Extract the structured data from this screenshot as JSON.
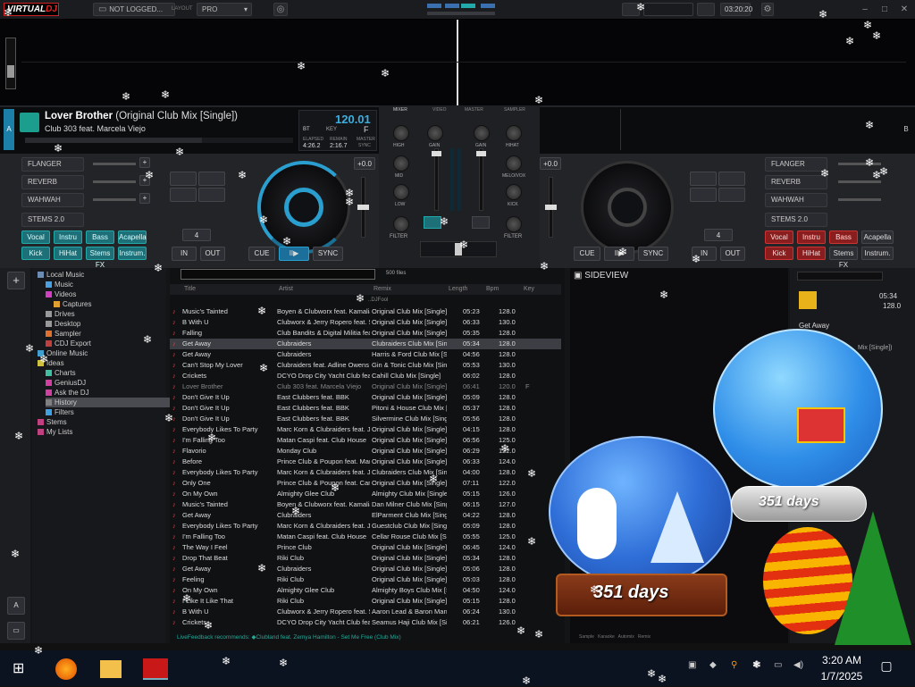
{
  "topbar": {
    "logo_a": "VIRTUAL",
    "logo_b": "DJ",
    "login": "NOT LOGGED...",
    "layout_label": "LAYOUT",
    "layout_value": "PRO",
    "time": "03:20:20"
  },
  "deckA": {
    "letter": "A",
    "title": "Lover Brother",
    "title_suffix": "(Original Club Mix [Single])",
    "artist": "Club 303 feat. Marcela Viejo",
    "bpm": "120.01",
    "key_label": "KEY",
    "key": "F",
    "bpm_small": "BT",
    "elapsed_label": "ELAPSED",
    "elapsed": "4:26.2",
    "remain_label": "REMAIN",
    "remain": "2:16.7",
    "master_label": "MASTER",
    "sync_label": "SYNC",
    "fx": [
      "FLANGER",
      "REVERB",
      "WAHWAH"
    ],
    "stems_label": "STEMS 2.0",
    "stems_row1": [
      "Vocal",
      "Instru",
      "Bass",
      "Acapella"
    ],
    "stems_row2": [
      "Kick",
      "HiHat",
      "Stems FX",
      "Instrum."
    ],
    "loop": "4",
    "in": "IN",
    "out": "OUT",
    "cue": "CUE",
    "play": "II▶",
    "sync": "SYNC",
    "pitch": "+0.0"
  },
  "deckB": {
    "letter": "B",
    "fx": [
      "FLANGER",
      "REVERB",
      "WAHWAH"
    ],
    "stems_label": "STEMS 2.0",
    "stems_row1": [
      "Vocal",
      "Instru",
      "Bass",
      "Acapella"
    ],
    "stems_row2": [
      "Kick",
      "HiHat",
      "Stems FX",
      "Instrum."
    ],
    "loop": "4",
    "in": "IN",
    "out": "OUT",
    "cue": "CUE",
    "play": "II▶",
    "sync": "SYNC",
    "pitch": "+0.0"
  },
  "mixer": {
    "tabs": [
      "MIXER",
      "VIDEO",
      "MASTER",
      "SAMPLER"
    ],
    "left": [
      "HIGH",
      "MID",
      "LOW",
      "FILTER"
    ],
    "center": [
      "GAIN",
      "GAIN"
    ],
    "right": [
      "HIHAT",
      "MELO/VOX",
      "KICK",
      "FILTER"
    ]
  },
  "browser": {
    "tree": [
      {
        "label": "Local Music",
        "color": "#6d8cb4",
        "indent": 0
      },
      {
        "label": "Music",
        "color": "#4aa0e0",
        "indent": 1
      },
      {
        "label": "Videos",
        "color": "#d040c0",
        "indent": 1
      },
      {
        "label": "Captures",
        "color": "#e0a030",
        "indent": 2
      },
      {
        "label": "Drives",
        "color": "#999999",
        "indent": 1
      },
      {
        "label": "Desktop",
        "color": "#999999",
        "indent": 1
      },
      {
        "label": "Sampler",
        "color": "#e07030",
        "indent": 1
      },
      {
        "label": "CDJ Export",
        "color": "#c04040",
        "indent": 1
      },
      {
        "label": "Online Music",
        "color": "#40a0d0",
        "indent": 0
      },
      {
        "label": "Ideas",
        "color": "#d0c040",
        "indent": 0
      },
      {
        "label": "Charts",
        "color": "#40c0a0",
        "indent": 1
      },
      {
        "label": "GeniusDJ",
        "color": "#d040a0",
        "indent": 1
      },
      {
        "label": "Ask the DJ",
        "color": "#d040a0",
        "indent": 1
      },
      {
        "label": "History",
        "color": "#808080",
        "indent": 1
      },
      {
        "label": "Filters",
        "color": "#40a0e0",
        "indent": 1
      },
      {
        "label": "Stems",
        "color": "#c04080",
        "indent": 0
      },
      {
        "label": "My Lists",
        "color": "#c04080",
        "indent": 0
      }
    ],
    "search_placeholder": "",
    "file_count": "500 files",
    "columns": [
      "Title",
      "Artist",
      "Remix",
      "Length",
      "Bpm",
      "Key"
    ],
    "prefolder": "..DJFool",
    "rows": [
      [
        "Music's Tainted",
        "Boyen & Clubworx feat. Kamalia",
        "Original Club Mix [Single]",
        "05:23",
        "128.0",
        ""
      ],
      [
        "B With U",
        "Clubworx & Jerry Ropero feat. Serah",
        "Original Club Mix [Single]",
        "06:33",
        "130.0",
        ""
      ],
      [
        "Falling",
        "Club Bandits & Digital Militia feat. Stefkie",
        "Original Club Mix [Single]",
        "05:35",
        "128.0",
        ""
      ],
      [
        "Get Away",
        "Clubraiders",
        "Clubraiders Club Mix [Single]",
        "05:34",
        "128.0",
        ""
      ],
      [
        "Get Away",
        "Clubraiders",
        "Harris & Ford Club Mix [Single]",
        "04:56",
        "128.0",
        ""
      ],
      [
        "Can't Stop My Lover",
        "Clubraiders feat. Adline Owens",
        "Gin & Tonic Club Mix [Single]",
        "05:53",
        "130.0",
        ""
      ],
      [
        "Crickets",
        "DCYO Drop City Yacht Club feat. Jeremih",
        "Cahill Club Mix [Single]",
        "06:02",
        "128.0",
        ""
      ],
      [
        "Lover Brother",
        "Club 303 feat. Marcela Viejo",
        "Original Club Mix [Single]",
        "06:41",
        "120.0",
        "F"
      ],
      [
        "Don't Give It Up",
        "East Clubbers feat. BBK",
        "Original Club Mix [Single]",
        "05:09",
        "128.0",
        ""
      ],
      [
        "Don't Give It Up",
        "East Clubbers feat. BBK",
        "Pitoni & House Club Mix [Single]",
        "05:37",
        "128.0",
        ""
      ],
      [
        "Don't Give It Up",
        "East Clubbers feat. BBK",
        "Silvermine Club Mix [Single]",
        "05:56",
        "128.0",
        ""
      ],
      [
        "Everybody Likes To Party",
        "Marc Korn & Clubraiders feat. Jay Jacob",
        "Original Club Mix [Single]",
        "04:15",
        "128.0",
        ""
      ],
      [
        "I'm Falling Too",
        "Matan Caspi feat. Club House",
        "Original Club Mix [Single]",
        "06:56",
        "125.0",
        ""
      ],
      [
        "Flavorio",
        "Monday Club",
        "Original Club Mix [Single]",
        "06:29",
        "122.0",
        ""
      ],
      [
        "Before",
        "Prince Club & Poupon feat. Mario",
        "Original Club Mix [Single]",
        "06:33",
        "124.0",
        ""
      ],
      [
        "Everybody Likes To Party",
        "Marc Korn & Clubraiders feat. Jay Jacob",
        "Clubraiders Club Mix [Single]",
        "04:00",
        "128.0",
        ""
      ],
      [
        "Only One",
        "Prince Club & Poupon feat. Camille David",
        "Original Club Mix [Single]",
        "07:11",
        "122.0",
        ""
      ],
      [
        "On My Own",
        "Almighty Glee Club",
        "Almighty Club Mix [Single]",
        "05:15",
        "126.0",
        ""
      ],
      [
        "Music's Tainted",
        "Boyen & Clubworx feat. Kamalia",
        "Dan Milner Club Mix [Single]",
        "06:15",
        "127.0",
        ""
      ],
      [
        "Get Away",
        "Clubraiders",
        "ElParment Club Mix [Single]",
        "04:22",
        "128.0",
        ""
      ],
      [
        "Everybody Likes To Party",
        "Marc Korn & Clubraiders feat. Jay Jacob",
        "Guestclub Club Mix [Single]",
        "05:09",
        "128.0",
        ""
      ],
      [
        "I'm Falling Too",
        "Matan Caspi feat. Club House",
        "Cellar Rouse Club Mix [Single]",
        "05:55",
        "125.0",
        ""
      ],
      [
        "The Way I Feel",
        "Prince Club",
        "Original Club Mix [Single]",
        "06:45",
        "124.0",
        ""
      ],
      [
        "Drop That Beat",
        "Riki Club",
        "Original Club Mix [Single]",
        "05:34",
        "128.0",
        ""
      ],
      [
        "Get Away",
        "Clubraiders",
        "Original Club Mix [Single]",
        "05:06",
        "128.0",
        ""
      ],
      [
        "Feeling",
        "Riki Club",
        "Original Club Mix [Single]",
        "05:03",
        "128.0",
        ""
      ],
      [
        "On My Own",
        "Almighty Glee Club",
        "Almighty Boys Club Mix [Single]",
        "04:50",
        "124.0",
        ""
      ],
      [
        "I Like It Like That",
        "Riki Club",
        "Original Club Mix [Single]",
        "05:15",
        "128.0",
        ""
      ],
      [
        "B With U",
        "Clubworx & Jerry Ropero feat. Serah",
        "Aaron Lead & Baron Mandela Club Mix [Single]",
        "06:24",
        "130.0",
        ""
      ],
      [
        "Crickets",
        "DCYO Drop City Yacht Club feat. Jeremih",
        "Seamus Haji Club Mix [Single]",
        "06:21",
        "126.0",
        ""
      ]
    ],
    "feedback": "LiveFeedback recommends: ◆Clubland feat. Zemya Hamilton - Set Me Free (Club Mix)",
    "sideview": "SIDEVIEW",
    "info_time": "05:34",
    "info_bpm": "128.0",
    "info_title": "Get Away",
    "info_remix": "Mix [Single])",
    "side_tabs": [
      "Sample",
      "Karaoke",
      "Automix",
      "Remix"
    ]
  },
  "globes": {
    "left_days": "351 days",
    "right_days": "351 days"
  },
  "taskbar": {
    "time": "3:20 AM",
    "date": "1/7/2025"
  }
}
